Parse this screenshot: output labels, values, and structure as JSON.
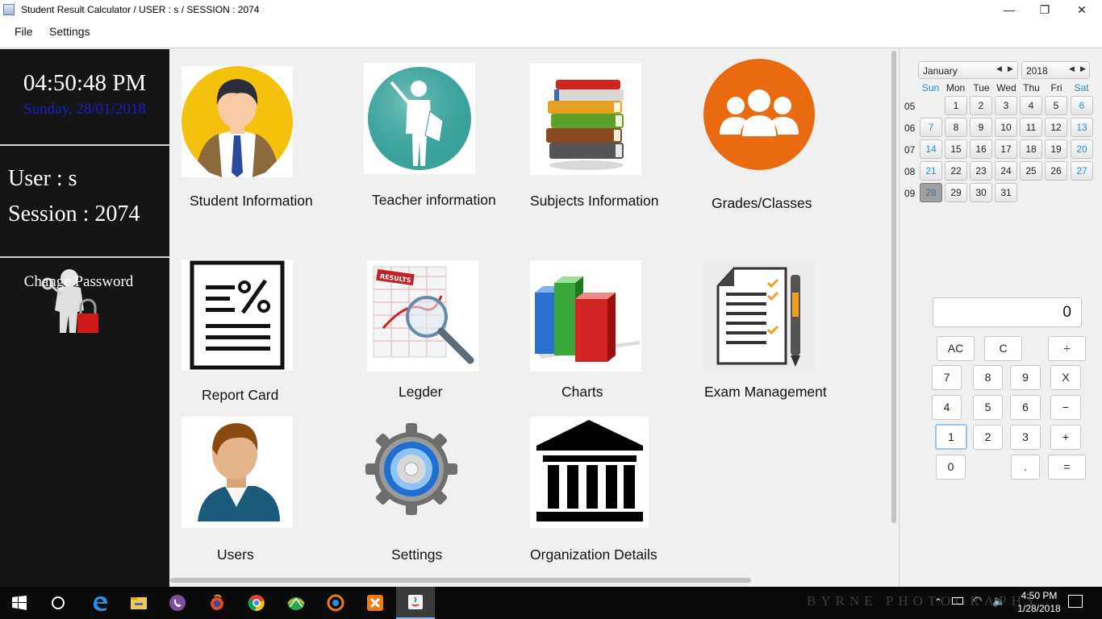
{
  "window": {
    "title": "Student Result Calculator /   USER :  s   /   SESSION : 2074",
    "minimize": "—",
    "maximize": "❐",
    "close": "✕"
  },
  "menu": {
    "file": "File",
    "settings": "Settings"
  },
  "sidebar": {
    "time": "04:50:48 PM",
    "date": "Sunday, 28/01/2018",
    "user": "User : s",
    "session": "Session : 2074",
    "change_password": "Change Password"
  },
  "tiles": {
    "student": "Student Information",
    "teacher": "Teacher information",
    "subjects": "Subjects Information",
    "grades": "Grades/Classes",
    "report": "Report Card",
    "ledger": "Legder",
    "ledger_badge": "RESULTS",
    "charts": "Charts",
    "exam": "Exam Management",
    "users": "Users",
    "settings": "Settings",
    "organization": "Organization Details"
  },
  "calendar": {
    "month": "January",
    "year": "2018",
    "headers": [
      "Sun",
      "Mon",
      "Tue",
      "Wed",
      "Thu",
      "Fri",
      "Sat"
    ],
    "weeks": [
      "05",
      "06",
      "07",
      "08",
      "09"
    ],
    "days": [
      [
        "",
        "1",
        "2",
        "3",
        "4",
        "5",
        "6"
      ],
      [
        "7",
        "8",
        "9",
        "10",
        "11",
        "12",
        "13"
      ],
      [
        "14",
        "15",
        "16",
        "17",
        "18",
        "19",
        "20"
      ],
      [
        "21",
        "22",
        "23",
        "24",
        "25",
        "26",
        "27"
      ],
      [
        "28",
        "29",
        "30",
        "31",
        "",
        "",
        ""
      ]
    ],
    "selected": "28"
  },
  "calculator": {
    "display": "0",
    "keys": {
      "ac": "AC",
      "c": "C",
      "div": "÷",
      "k7": "7",
      "k8": "8",
      "k9": "9",
      "mul": "X",
      "k4": "4",
      "k5": "5",
      "k6": "6",
      "sub": "−",
      "k1": "1",
      "k2": "2",
      "k3": "3",
      "add": "+",
      "k0": "0",
      "dot": ".",
      "eq": "="
    }
  },
  "taskbar": {
    "watermark": "BYRNE PHOTOGRAPHY",
    "time": "4:50 PM",
    "date": "1/28/2018"
  },
  "colors": {
    "sidebar_bg": "#151515",
    "date_text": "#1c1ccf",
    "weekend": "#2a8fc7",
    "grades_orange": "#ea6a10"
  }
}
